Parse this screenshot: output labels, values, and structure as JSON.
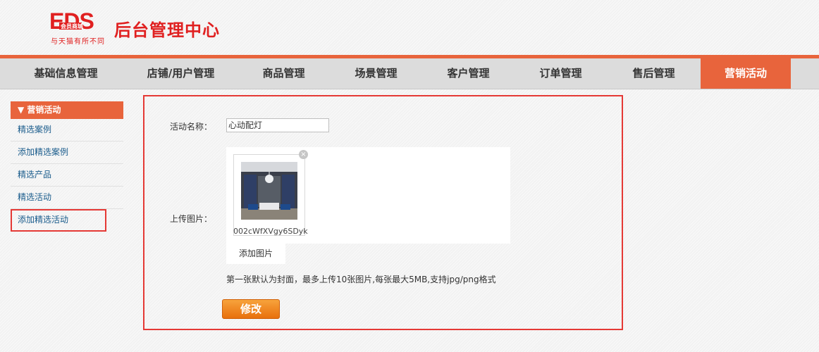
{
  "header": {
    "logo_text": "EDS 会员商城",
    "title": "后台管理中心",
    "slogan": "与天猫有所不同"
  },
  "nav": {
    "items": [
      {
        "label": "基础信息管理"
      },
      {
        "label": "店铺/用户管理"
      },
      {
        "label": "商品管理"
      },
      {
        "label": "场景管理"
      },
      {
        "label": "客户管理"
      },
      {
        "label": "订单管理"
      },
      {
        "label": "售后管理"
      },
      {
        "label": "营销活动"
      }
    ],
    "active": "营销活动"
  },
  "sidebar": {
    "heading": "▼ 营销活动",
    "items": [
      {
        "label": "精选案例"
      },
      {
        "label": "添加精选案例"
      },
      {
        "label": "精选产品"
      },
      {
        "label": "精选活动"
      },
      {
        "label": "添加精选活动"
      }
    ],
    "selected": "添加精选活动"
  },
  "form": {
    "name_label": "活动名称：",
    "name_value": "心动配灯",
    "upload_label": "上传图片：",
    "uploaded_file": "002cWfXVgy6SDyk",
    "add_image_label": "添加图片",
    "hint": "第一张默认为封面，最多上传10张图片,每张最大5MB,支持jpg/png格式",
    "submit_label": "修改",
    "remove_symbol": "×"
  },
  "colors": {
    "accent": "#e8643c",
    "brand_red": "#e02020",
    "highlight_border": "#e53935",
    "button": "#f08a1e"
  }
}
